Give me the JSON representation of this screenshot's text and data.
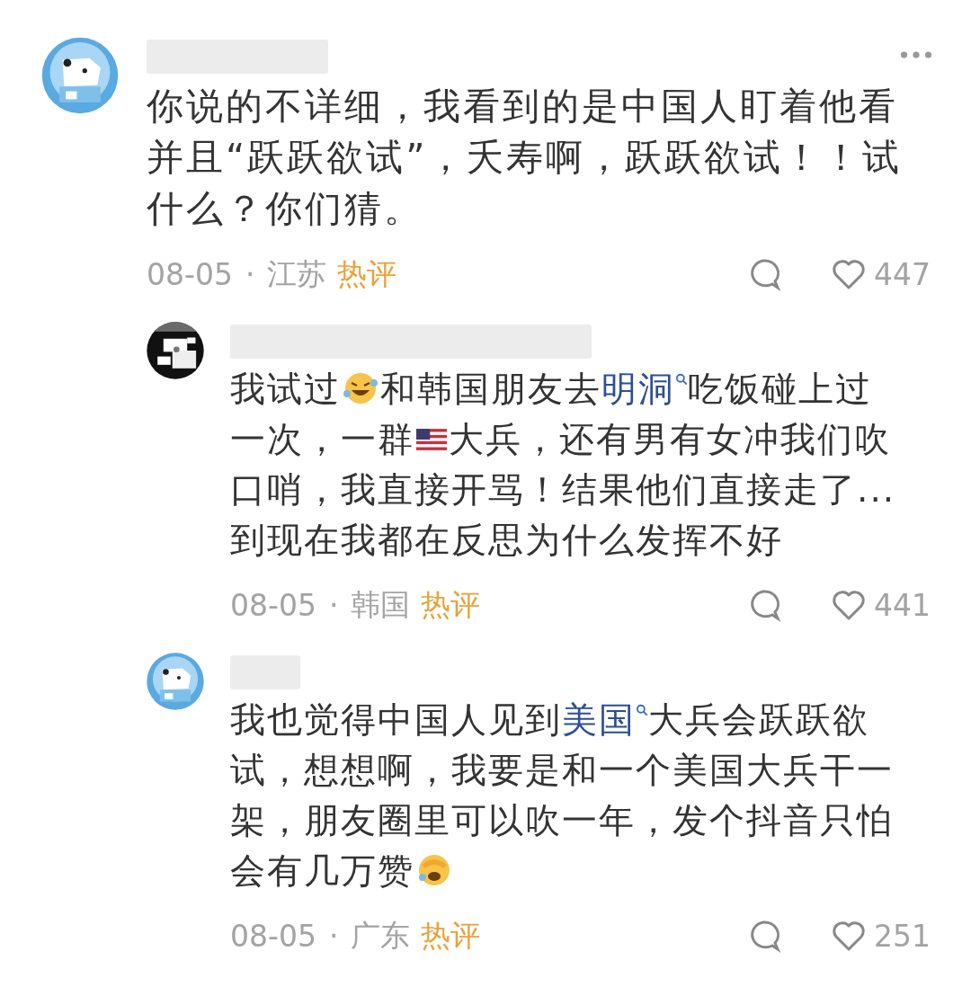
{
  "comments": [
    {
      "avatar": {
        "kind": "bear"
      },
      "more": true,
      "text": [
        {
          "kind": "text",
          "text": "你说的不详细，我看到的是中国人盯着他看并且“跃跃欲试”，夭寿啊，跃跃欲试！！试什么？你们猜。"
        }
      ],
      "date": "08-05",
      "separator": "·",
      "location": "江苏",
      "badge": "热评",
      "likes": "447",
      "replies": [
        {
          "text": [
            {
              "kind": "text",
              "text": "我试过"
            },
            {
              "kind": "grin"
            },
            {
              "kind": "text",
              "text": "和韩国朋友去"
            },
            {
              "kind": "link",
              "text": "明洞"
            },
            {
              "kind": "text",
              "text": "吃饭碰上过一次，一群"
            },
            {
              "kind": "flag"
            },
            {
              "kind": "text",
              "text": "大兵，还有男有女冲我们吹口哨，我直接开骂！结果他们直接走了...到现在我都在反思为什么发挥不好"
            }
          ],
          "date": "08-05",
          "separator": "·",
          "location": "韩国",
          "badge": "热评",
          "likes": "441"
        },
        {
          "avatar": {
            "kind": "bear"
          },
          "text": [
            {
              "kind": "text",
              "text": "我也觉得中国人见到"
            },
            {
              "kind": "link",
              "text": "美国"
            },
            {
              "kind": "text",
              "text": "大兵会跃跃欲试，想想啊，我要是和一个美国大兵干一架，朋友圈里可以吹一年，发个抖音只怕会有几万赞"
            },
            {
              "kind": "facepalm"
            }
          ],
          "date": "08-05",
          "separator": "·",
          "location": "广东",
          "badge": "热评",
          "likes": "251"
        }
      ]
    }
  ]
}
